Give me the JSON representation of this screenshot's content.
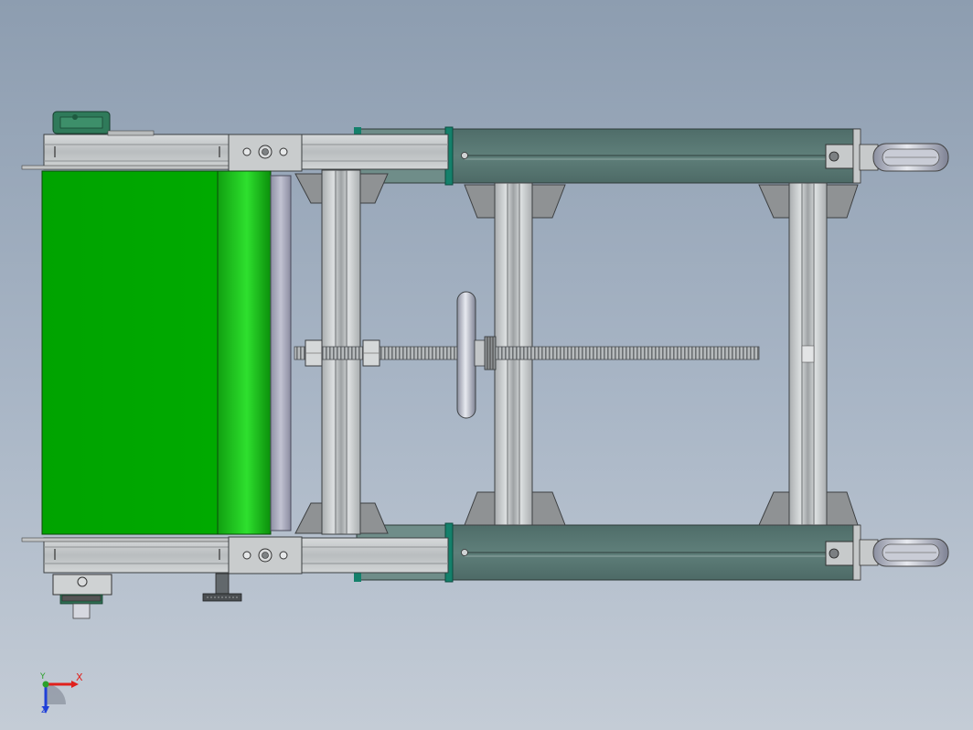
{
  "triad": {
    "x_label": "X",
    "y_label": "Y",
    "z_label": "Z",
    "x_color": "#e0201c",
    "y_color": "#2aa02a",
    "z_color": "#2040d8"
  },
  "colors": {
    "belt_green": "#00a800",
    "rail_teal": "#597772",
    "aluminum": "#c9cccd",
    "steel_dark": "#5a5f63",
    "motor_green": "#2f7a5a"
  }
}
